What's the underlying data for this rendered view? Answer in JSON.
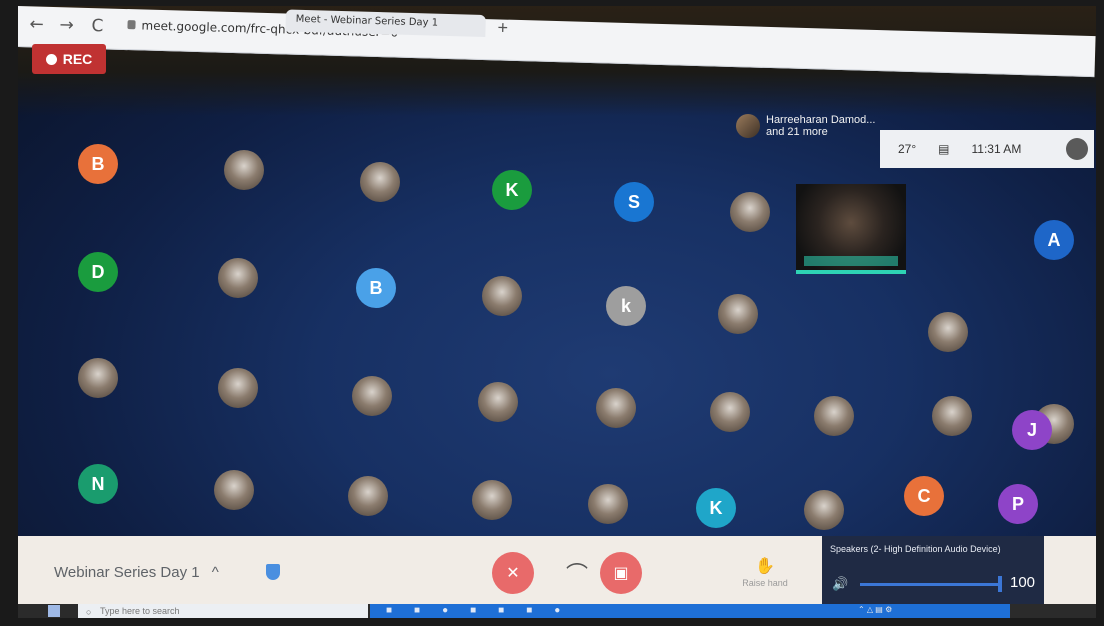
{
  "browser": {
    "tab_title": "Meet - Webinar Series Day 1",
    "url": "meet.google.com/frc-qhcx-bdf/authuser=0",
    "back_icon": "←",
    "forward_icon": "→",
    "reload_icon": "C",
    "new_tab_icon": "+"
  },
  "recording": {
    "label": "REC"
  },
  "presenter": {
    "name": "Harreeharan Damod...",
    "more": "and 21 more"
  },
  "clock": {
    "temp": "27°",
    "time": "11:31 AM"
  },
  "participants": [
    {
      "initial": "B",
      "color": "#e8713a"
    },
    {
      "initial": "",
      "color": "photo"
    },
    {
      "initial": "",
      "color": "photo"
    },
    {
      "initial": "K",
      "color": "#1a9c3e"
    },
    {
      "initial": "S",
      "color": "#1976d2"
    },
    {
      "initial": "",
      "color": "photo"
    },
    {
      "initial": "A",
      "color": "#1e66c8"
    },
    {
      "initial": "D",
      "color": "#1a9c3e"
    },
    {
      "initial": "",
      "color": "photo"
    },
    {
      "initial": "B",
      "color": "#4aa1e8"
    },
    {
      "initial": "",
      "color": "photo"
    },
    {
      "initial": "k",
      "color": "#9e9e9e"
    },
    {
      "initial": "",
      "color": "photo"
    },
    {
      "initial": "",
      "color": "photo"
    },
    {
      "initial": "",
      "color": "photo"
    },
    {
      "initial": "",
      "color": "photo"
    },
    {
      "initial": "",
      "color": "photo"
    },
    {
      "initial": "",
      "color": "photo"
    },
    {
      "initial": "",
      "color": "photo"
    },
    {
      "initial": "",
      "color": "photo"
    },
    {
      "initial": "",
      "color": "photo"
    },
    {
      "initial": "",
      "color": "photo"
    },
    {
      "initial": "J",
      "color": "#8e44c8"
    },
    {
      "initial": "N",
      "color": "#1a9c6e"
    },
    {
      "initial": "",
      "color": "photo"
    },
    {
      "initial": "",
      "color": "photo"
    },
    {
      "initial": "",
      "color": "photo"
    },
    {
      "initial": "",
      "color": "photo"
    },
    {
      "initial": "K",
      "color": "#1fa6c9"
    },
    {
      "initial": "",
      "color": "photo"
    },
    {
      "initial": "",
      "color": "photo"
    },
    {
      "initial": "C",
      "color": "#e8713a"
    },
    {
      "initial": "P",
      "color": "#8e44c8"
    }
  ],
  "meeting": {
    "title": "Webinar Series Day 1",
    "chevron": "^",
    "raise_hand_label": "Raise hand"
  },
  "speakers": {
    "device": "Speakers (2- High Definition Audio Device)",
    "volume": 100
  },
  "taskbar": {
    "search_placeholder": "Type here to search"
  }
}
